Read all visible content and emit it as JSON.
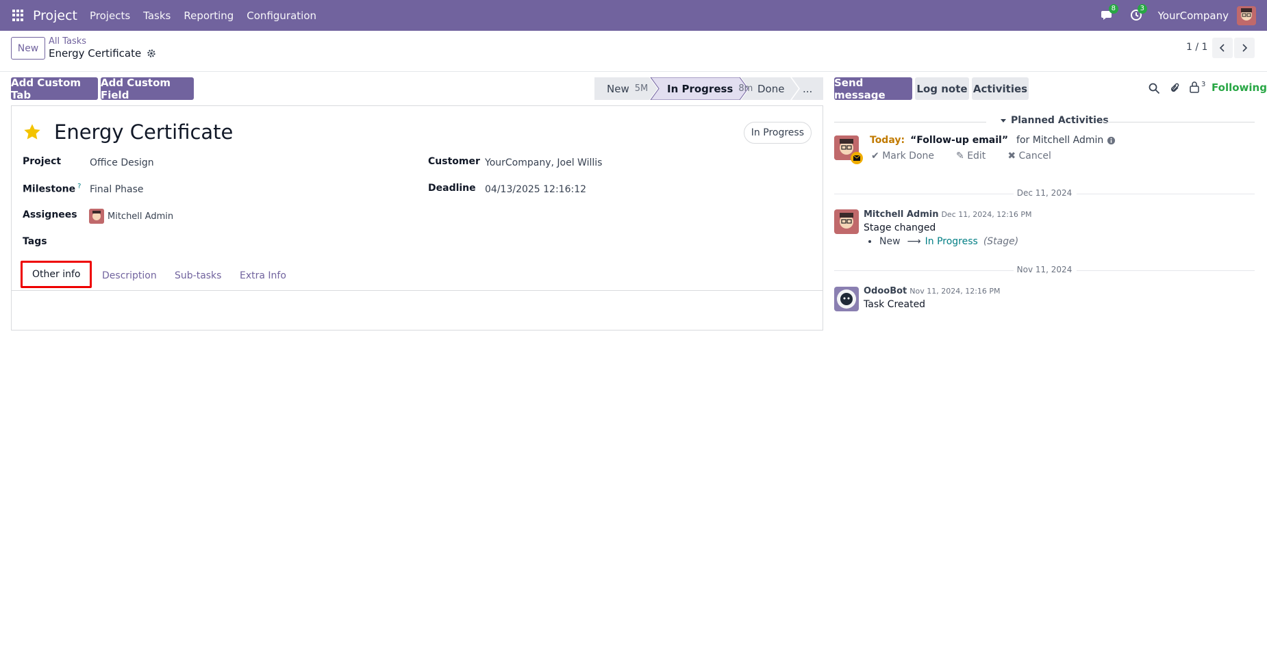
{
  "navbar": {
    "brand": "Project",
    "menu": [
      "Projects",
      "Tasks",
      "Reporting",
      "Configuration"
    ],
    "messages_count": "8",
    "activities_count": "3",
    "company": "YourCompany"
  },
  "control": {
    "new_label": "New",
    "breadcrumb_parent": "All Tasks",
    "breadcrumb_current": "Energy Certificate",
    "pager": "1 / 1"
  },
  "actions": {
    "add_custom_tab": "Add Custom Tab",
    "add_custom_field": "Add Custom Field"
  },
  "stages": [
    {
      "label": "New",
      "duration": "5M"
    },
    {
      "label": "In Progress",
      "duration": "8m"
    },
    {
      "label": "Done",
      "duration": ""
    },
    {
      "label": "...",
      "duration": ""
    }
  ],
  "task": {
    "title": "Energy Certificate",
    "status": "In Progress",
    "fields": {
      "project_label": "Project",
      "project": "Office Design",
      "milestone_label": "Milestone",
      "milestone_help": "?",
      "milestone": "Final Phase",
      "assignees_label": "Assignees",
      "assignee": "Mitchell Admin",
      "tags_label": "Tags",
      "customer_label": "Customer",
      "customer": "YourCompany, Joel Willis",
      "deadline_label": "Deadline",
      "deadline": "04/13/2025 12:16:12"
    },
    "tabs": [
      "Other info",
      "Description",
      "Sub-tasks",
      "Extra Info"
    ]
  },
  "chatter": {
    "send_message": "Send message",
    "log_note": "Log note",
    "activities": "Activities",
    "followers_count": "3",
    "following": "Following",
    "planned_title": "Planned Activities",
    "activity": {
      "when": "Today:",
      "summary": "“Follow-up email”",
      "for": "for Mitchell Admin",
      "mark_done": "Mark Done",
      "edit": "Edit",
      "cancel": "Cancel"
    },
    "messages": [
      {
        "date_sep": "Dec 11, 2024",
        "author": "Mitchell Admin",
        "date": "Dec 11, 2024, 12:16 PM",
        "body": "Stage changed",
        "tracking": {
          "old": "New",
          "new": "In Progress",
          "field": "(Stage)"
        }
      },
      {
        "date_sep": "Nov 11, 2024",
        "author": "OdooBot",
        "date": "Nov 11, 2024, 12:16 PM",
        "body": "Task Created"
      }
    ]
  },
  "colors": {
    "brand": "#71639e",
    "success": "#28a745",
    "accent": "#017e84",
    "highlight": "#e00000",
    "today": "#c17a00",
    "star": "#f3c300"
  }
}
